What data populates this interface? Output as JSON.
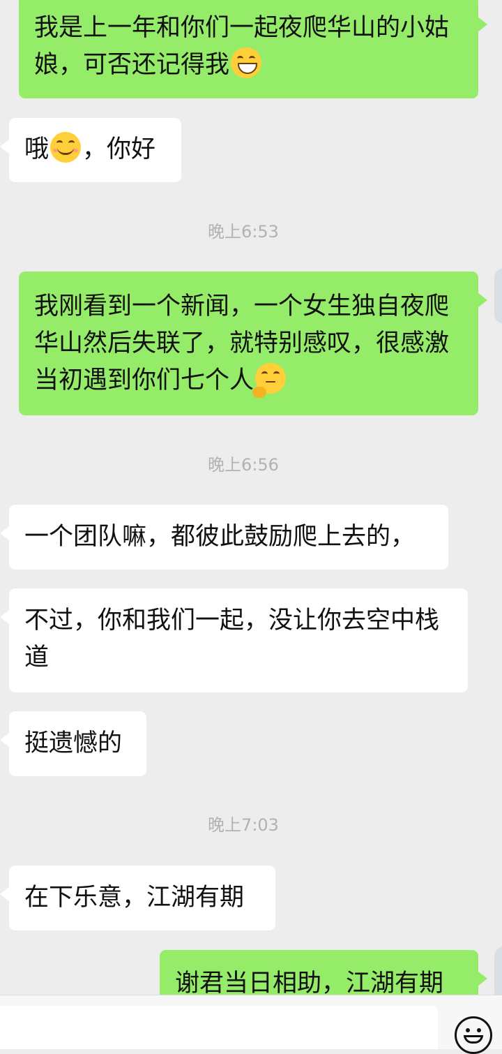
{
  "messages": [
    {
      "side": "out",
      "text": "我是上一年和你们一起夜爬华山的小姑娘，可否还记得我",
      "emoji": "grinning-face"
    },
    {
      "side": "in",
      "text_before": "哦",
      "emoji": "smiling-face",
      "text_after": "，你好"
    },
    {
      "kind": "timestamp",
      "text": "晚上6:53"
    },
    {
      "side": "out",
      "text": "我刚看到一个新闻，一个女生独自夜爬华山然后失联了，就特别感叹，很感激当初遇到你们七个人",
      "emoji": "thinking-face"
    },
    {
      "kind": "timestamp",
      "text": "晚上6:56"
    },
    {
      "side": "in",
      "text": "一个团队嘛，都彼此鼓励爬上去的，"
    },
    {
      "side": "in",
      "text": "不过，你和我们一起，没让你去空中栈道"
    },
    {
      "side": "in",
      "text": "挺遗憾的"
    },
    {
      "kind": "timestamp",
      "text": "晚上7:03"
    },
    {
      "side": "in",
      "text": "在下乐意，江湖有期"
    },
    {
      "side": "out",
      "text": "谢君当日相助，江湖有期"
    }
  ],
  "input_bar": {
    "emoji_button_icon": "smiley-face-icon"
  },
  "colors": {
    "outgoing": "#95ec69",
    "incoming": "#ffffff",
    "background": "#ededed",
    "timestamp": "#b2b2b2"
  }
}
